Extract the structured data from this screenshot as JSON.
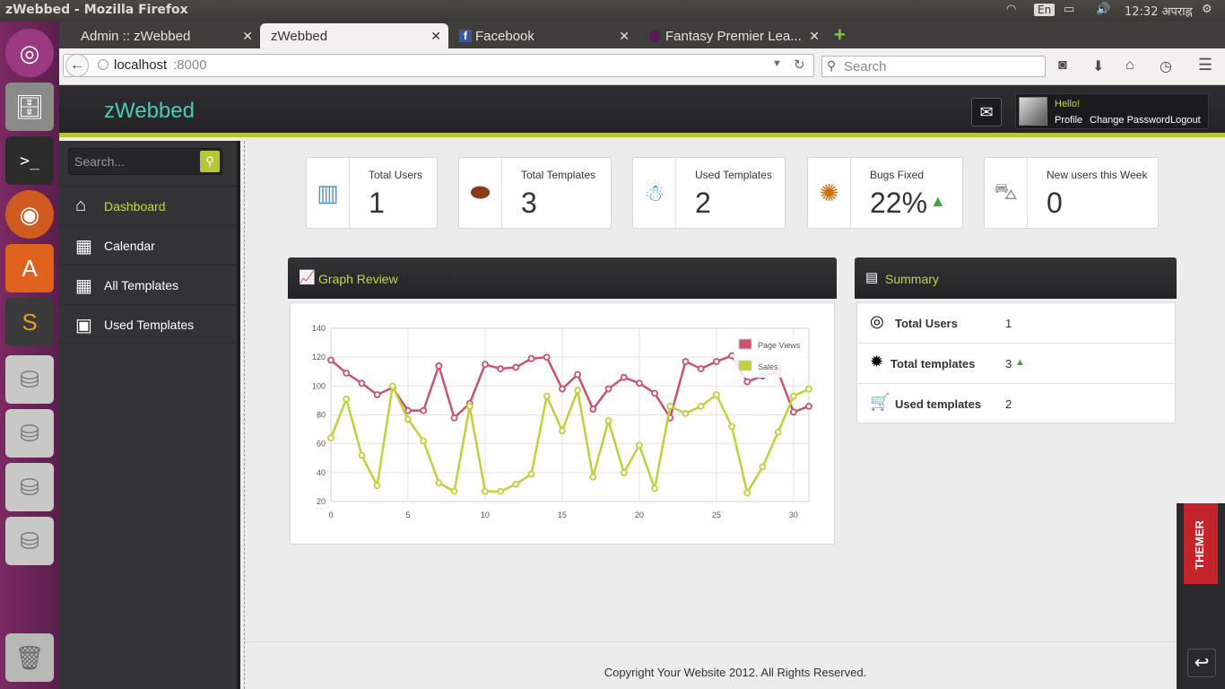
{
  "os": {
    "window_title": "zWebbed - Mozilla Firefox",
    "keyboard": "En",
    "time": "12:32 अपराह्न"
  },
  "browser": {
    "tabs": [
      {
        "label": "Admin :: zWebbed",
        "active": false
      },
      {
        "label": "zWebbed",
        "active": true
      },
      {
        "label": "Facebook",
        "active": false
      },
      {
        "label": "Fantasy Premier Lea...",
        "active": false
      }
    ],
    "url": "localhost:8000",
    "url_host": "localhost",
    "url_port": ":8000",
    "search_placeholder": "Search"
  },
  "header": {
    "brand": "zWebbed",
    "greeting": "Hello!",
    "profile": "Profile",
    "change_password": "Change Password",
    "logout": "Logout"
  },
  "sidebar": {
    "search_placeholder": "Search...",
    "items": [
      {
        "label": "Dashboard",
        "icon": "home-icon",
        "active": true
      },
      {
        "label": "Calendar",
        "icon": "calendar-icon"
      },
      {
        "label": "All Templates",
        "icon": "grid-icon"
      },
      {
        "label": "Used Templates",
        "icon": "images-icon"
      }
    ]
  },
  "stats": [
    {
      "label": "Total Users",
      "value": "1",
      "icon": "building-icon"
    },
    {
      "label": "Total Templates",
      "value": "3",
      "icon": "football-icon"
    },
    {
      "label": "Used Templates",
      "value": "2",
      "icon": "person-icon"
    },
    {
      "label": "Bugs Fixed",
      "value": "22%",
      "icon": "bug-icon",
      "trend": "up"
    },
    {
      "label": "New users this Week",
      "value": "0",
      "icon": "car-icon"
    }
  ],
  "graph_panel": {
    "title": "Graph Review"
  },
  "summary_panel": {
    "title": "Summary",
    "rows": [
      {
        "label": "Total Users",
        "value": "1",
        "icon": "lifebuoy-icon"
      },
      {
        "label": "Total templates",
        "value": "3",
        "icon": "gear-icon",
        "trend": "up"
      },
      {
        "label": "Used templates",
        "value": "2",
        "icon": "cart-icon"
      }
    ]
  },
  "footer": {
    "copyright": "Copyright Your Website 2012. All Rights Reserved."
  },
  "themer": {
    "label": "THEMER"
  },
  "colors": {
    "accent": "#b6c637",
    "brand": "#4cc8b5",
    "page_views": "#c9526e",
    "sales": "#bfd13a"
  },
  "chart_data": {
    "type": "line",
    "x": [
      0,
      1,
      2,
      3,
      4,
      5,
      6,
      7,
      8,
      9,
      10,
      11,
      12,
      13,
      14,
      15,
      16,
      17,
      18,
      19,
      20,
      21,
      22,
      23,
      24,
      25,
      26,
      27,
      28,
      29,
      30,
      31
    ],
    "series": [
      {
        "name": "Page Views",
        "values": [
          118,
          109,
          102,
          94,
          99,
          83,
          83,
          114,
          78,
          88,
          115,
          112,
          113,
          119,
          120,
          98,
          108,
          84,
          98,
          106,
          102,
          95,
          78,
          117,
          112,
          117,
          121,
          103,
          107,
          110,
          82,
          86
        ]
      },
      {
        "name": "Sales",
        "values": [
          64,
          91,
          52,
          31,
          100,
          77,
          62,
          33,
          27,
          86,
          27,
          27,
          32,
          39,
          93,
          69,
          97,
          37,
          76,
          40,
          59,
          29,
          86,
          81,
          86,
          94,
          72,
          26,
          44,
          68,
          93,
          98
        ]
      }
    ],
    "xticks": [
      0,
      5,
      10,
      15,
      20,
      25,
      30
    ],
    "yticks": [
      20,
      40,
      60,
      80,
      100,
      120,
      140
    ],
    "ylim": [
      20,
      140
    ],
    "xlim": [
      0,
      31
    ],
    "grid": true,
    "legend": "top-right"
  }
}
